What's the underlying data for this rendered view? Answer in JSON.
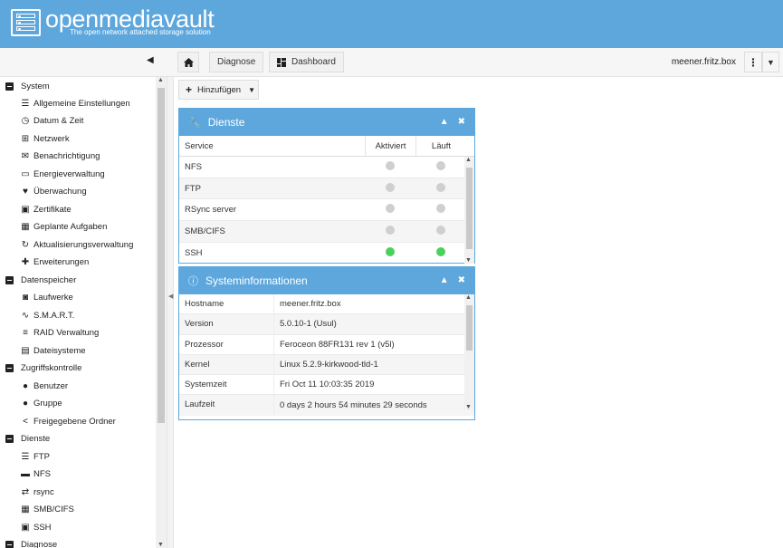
{
  "header": {
    "app_name": "openmediavault",
    "tagline": "The open network attached storage solution"
  },
  "toolbar": {
    "breadcrumbs": [
      {
        "label": "Diagnose"
      },
      {
        "label": "Dashboard"
      }
    ],
    "hostname": "meener.fritz.box"
  },
  "sidebar": {
    "groups": [
      {
        "label": "System",
        "items": [
          {
            "label": "Allgemeine Einstellungen",
            "icon": "sliders-icon"
          },
          {
            "label": "Datum & Zeit",
            "icon": "clock-icon"
          },
          {
            "label": "Netzwerk",
            "icon": "network-icon"
          },
          {
            "label": "Benachrichtigung",
            "icon": "envelope-icon"
          },
          {
            "label": "Energieverwaltung",
            "icon": "battery-icon"
          },
          {
            "label": "Überwachung",
            "icon": "heartbeat-icon"
          },
          {
            "label": "Zertifikate",
            "icon": "certificate-icon"
          },
          {
            "label": "Geplante Aufgaben",
            "icon": "calendar-icon"
          },
          {
            "label": "Aktualisierungsverwaltung",
            "icon": "refresh-icon"
          },
          {
            "label": "Erweiterungen",
            "icon": "puzzle-icon"
          }
        ]
      },
      {
        "label": "Datenspeicher",
        "items": [
          {
            "label": "Laufwerke",
            "icon": "disk-icon"
          },
          {
            "label": "S.M.A.R.T.",
            "icon": "pulse-icon"
          },
          {
            "label": "RAID Verwaltung",
            "icon": "database-icon"
          },
          {
            "label": "Dateisysteme",
            "icon": "book-icon"
          }
        ]
      },
      {
        "label": "Zugriffskontrolle",
        "items": [
          {
            "label": "Benutzer",
            "icon": "user-icon"
          },
          {
            "label": "Gruppe",
            "icon": "users-icon"
          },
          {
            "label": "Freigegebene Ordner",
            "icon": "share-icon"
          }
        ]
      },
      {
        "label": "Dienste",
        "items": [
          {
            "label": "FTP",
            "icon": "server-icon"
          },
          {
            "label": "NFS",
            "icon": "desktop-icon"
          },
          {
            "label": "rsync",
            "icon": "sync-icon"
          },
          {
            "label": "SMB/CIFS",
            "icon": "windows-icon"
          },
          {
            "label": "SSH",
            "icon": "terminal-icon"
          }
        ]
      },
      {
        "label": "Diagnose",
        "items": []
      }
    ]
  },
  "main": {
    "add_button": "Hinzufügen",
    "services_panel": {
      "title": "Dienste",
      "columns": [
        "Service",
        "Aktiviert",
        "Läuft"
      ],
      "rows": [
        {
          "service": "NFS",
          "enabled": false,
          "running": false
        },
        {
          "service": "FTP",
          "enabled": false,
          "running": false
        },
        {
          "service": "RSync server",
          "enabled": false,
          "running": false
        },
        {
          "service": "SMB/CIFS",
          "enabled": false,
          "running": false
        },
        {
          "service": "SSH",
          "enabled": true,
          "running": true
        }
      ]
    },
    "sysinfo_panel": {
      "title": "Systeminformationen",
      "rows": [
        {
          "key": "Hostname",
          "value": "meener.fritz.box"
        },
        {
          "key": "Version",
          "value": "5.0.10-1 (Usul)"
        },
        {
          "key": "Prozessor",
          "value": "Feroceon 88FR131 rev 1 (v5l)"
        },
        {
          "key": "Kernel",
          "value": "Linux 5.2.9-kirkwood-tld-1"
        },
        {
          "key": "Systemzeit",
          "value": "Fri Oct 11 10:03:35 2019"
        },
        {
          "key": "Laufzeit",
          "value": "0 days 2 hours 54 minutes 29 seconds"
        }
      ]
    }
  },
  "colors": {
    "accent": "#5ea7dd",
    "status_on": "#4cd05c",
    "status_off": "#cfcfcf"
  }
}
